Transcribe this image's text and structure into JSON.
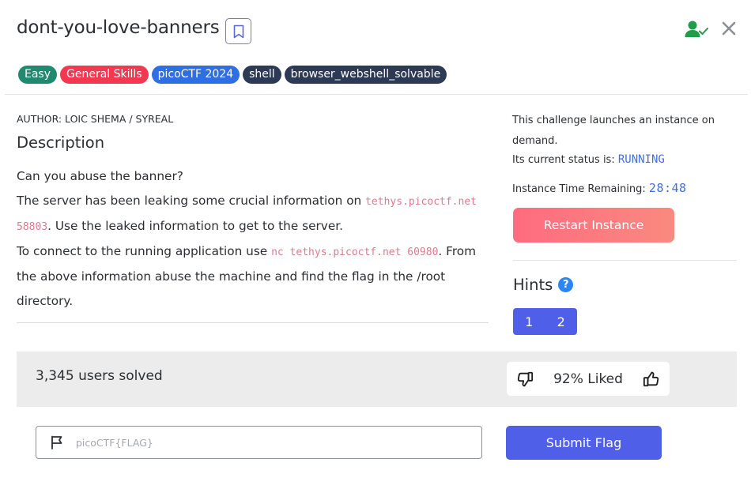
{
  "challenge": {
    "title": "dont-you-love-banners"
  },
  "tags": [
    {
      "label": "Easy",
      "color": "#1f8a70"
    },
    {
      "label": "General Skills",
      "color": "#f2394f"
    },
    {
      "label": "picoCTF 2024",
      "color": "#2f6fe4"
    },
    {
      "label": "shell",
      "color": "#2d3a55"
    },
    {
      "label": "browser_webshell_solvable",
      "color": "#2d3a55"
    }
  ],
  "description": {
    "author": "AUTHOR: LOIC SHEMA / SYREAL",
    "heading": "Description",
    "line1": "Can you abuse the banner?",
    "line2_prefix": "The server has been leaking some crucial information on ",
    "line2_code": "tethys.picoctf.net 58803",
    "line2_suffix": ". Use the leaked information to get to the server.",
    "line3_prefix": "To connect to the running application use ",
    "line3_code": "nc tethys.picoctf.net 60980",
    "line3_suffix": ". From the above information abuse the machine and find the flag in the /root directory."
  },
  "instance": {
    "launch_text": "This challenge launches an instance on demand.",
    "status_label": "Its current status is: ",
    "status_value": "RUNNING",
    "time_label": "Instance Time Remaining: ",
    "time_value": "28:48",
    "restart_label": "Restart Instance"
  },
  "hints": {
    "heading": "Hints",
    "help_icon": "?",
    "items": [
      "1",
      "2"
    ]
  },
  "stats": {
    "solved": "3,345 users solved",
    "liked": "92% Liked"
  },
  "flag": {
    "placeholder": "picoCTF{FLAG}",
    "submit_label": "Submit Flag"
  },
  "colors": {
    "accent": "#4f5fe8",
    "status": "#3f6ee8",
    "code": "#e27a8e",
    "restart": "#ff6b7f",
    "solved_icon": "#1f9e4a"
  },
  "icons": [
    "bookmark-icon",
    "user-check-icon",
    "close-icon",
    "help-icon",
    "thumbs-down-icon",
    "thumbs-up-icon",
    "flag-icon"
  ]
}
